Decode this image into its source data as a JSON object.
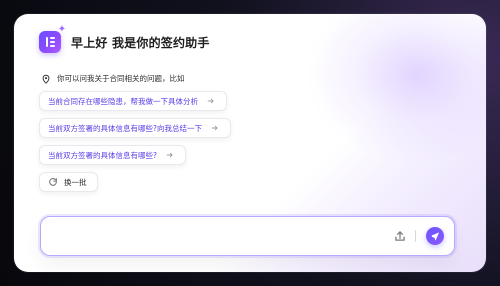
{
  "header": {
    "title": "早上好  我是你的签约助手",
    "logo_icon": "contract-assistant-logo-icon"
  },
  "hint": {
    "text": "你可以问我关于合同相关的问题，比如",
    "icon": "location-pin-icon"
  },
  "suggestions": [
    {
      "label": "当前合同存在哪些隐患，帮我做一下具体分析",
      "icon": "arrow-right-icon"
    },
    {
      "label": "当前双方签署的具体信息有哪些?向我总结一下",
      "icon": "arrow-right-icon"
    },
    {
      "label": "当前双方签署的具体信息有哪些?",
      "icon": "arrow-right-icon"
    }
  ],
  "refresh": {
    "label": "换一批",
    "icon": "refresh-icon"
  },
  "input": {
    "value": "",
    "placeholder": ""
  },
  "actions": {
    "upload_icon": "upload-icon",
    "send_icon": "send-icon"
  },
  "colors": {
    "accent": "#6A56FF",
    "suggestion_text": "#5A3DE6",
    "panel_bg": "#FFFFFF"
  }
}
